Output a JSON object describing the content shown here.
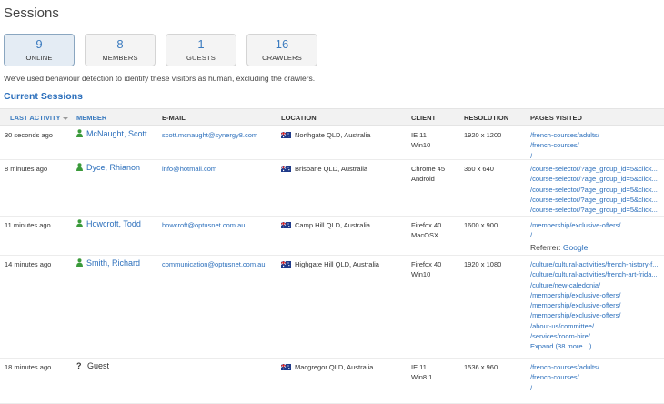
{
  "page_title": "Sessions",
  "stats": [
    {
      "value": "9",
      "label": "ONLINE",
      "active": true
    },
    {
      "value": "8",
      "label": "MEMBERS",
      "active": false
    },
    {
      "value": "1",
      "label": "GUESTS",
      "active": false
    },
    {
      "value": "16",
      "label": "CRAWLERS",
      "active": false
    }
  ],
  "note": "We've used behaviour detection to identify these visitors as human, excluding the crawlers.",
  "section_title": "Current Sessions",
  "columns": {
    "last_activity": "LAST ACTIVITY",
    "member": "MEMBER",
    "email": "E-MAIL",
    "location": "LOCATION",
    "client": "CLIENT",
    "resolution": "RESOLUTION",
    "pages": "PAGES VISITED"
  },
  "colors": {
    "accent": "#2a6ebb",
    "member_icon": "#3a9a3a"
  },
  "sessions": [
    {
      "last_activity": "30 seconds ago",
      "member": "McNaught, Scott",
      "is_guest": false,
      "email": "scott.mcnaught@synergy8.com",
      "location": "Northgate QLD, Australia",
      "client_browser": "IE 11",
      "client_os": "Win10",
      "resolution": "1920 x 1200",
      "pages": [
        "/french-courses/adults/",
        "/french-courses/",
        "/"
      ],
      "referrer": null
    },
    {
      "last_activity": "8 minutes ago",
      "member": "Dyce, Rhianon",
      "is_guest": false,
      "email": "info@hotmail.com",
      "location": "Brisbane QLD, Australia",
      "client_browser": "Chrome 45",
      "client_os": "Android",
      "resolution": "360 x 640",
      "pages": [
        "/course-selector/?age_group_id=5&click...",
        "/course-selector/?age_group_id=5&click...",
        "/course-selector/?age_group_id=5&click...",
        "/course-selector/?age_group_id=5&click...",
        "/course-selector/?age_group_id=5&click..."
      ],
      "referrer": null
    },
    {
      "last_activity": "11 minutes ago",
      "member": "Howcroft, Todd",
      "is_guest": false,
      "email": "howcroft@optusnet.com.au",
      "location": "Camp Hill QLD, Australia",
      "client_browser": "Firefox 40",
      "client_os": "MacOSX",
      "resolution": "1600 x 900",
      "pages": [
        "/membership/exclusive-offers/",
        "/"
      ],
      "referrer": {
        "label": "Referrer:",
        "value": "Google"
      }
    },
    {
      "last_activity": "14 minutes ago",
      "member": "Smith, Richard",
      "is_guest": false,
      "email": "communication@optusnet.com.au",
      "location": "Highgate Hill QLD, Australia",
      "client_browser": "Firefox 40",
      "client_os": "Win10",
      "resolution": "1920 x 1080",
      "pages": [
        "/culture/cultural-activities/french-history-f...",
        "/culture/cultural-activities/french-art-frida...",
        "/culture/new-caledonia/",
        "/membership/exclusive-offers/",
        "/membership/exclusive-offers/",
        "/membership/exclusive-offers/",
        "/about-us/committee/",
        "/services/room-hire/",
        "Expand (38 more…)"
      ],
      "referrer": null
    },
    {
      "last_activity": "18 minutes ago",
      "member": "Guest",
      "is_guest": true,
      "email": "",
      "location": "Macgregor QLD, Australia",
      "client_browser": "IE 11",
      "client_os": "Win8.1",
      "resolution": "1536 x 960",
      "pages": [
        "/french-courses/adults/",
        "/french-courses/",
        "/"
      ],
      "referrer": null
    }
  ]
}
